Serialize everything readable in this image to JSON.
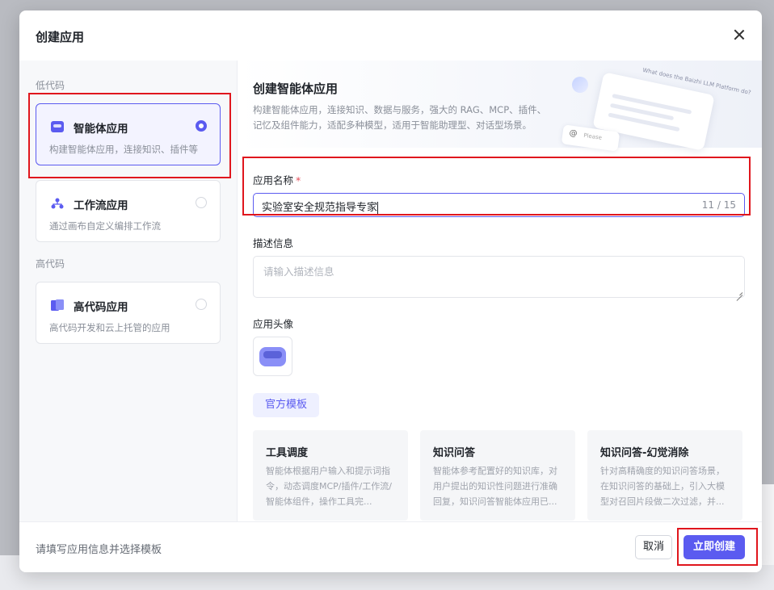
{
  "dialog": {
    "title": "创建应用"
  },
  "sidebar": {
    "low_code_label": "低代码",
    "high_code_label": "高代码",
    "types": [
      {
        "title": "智能体应用",
        "desc": "构建智能体应用，连接知识、插件等",
        "selected": true
      },
      {
        "title": "工作流应用",
        "desc": "通过画布自定义编排工作流",
        "selected": false
      },
      {
        "title": "高代码应用",
        "desc": "高代码开发和云上托管的应用",
        "selected": false
      }
    ]
  },
  "banner": {
    "title": "创建智能体应用",
    "desc": "构建智能体应用，连接知识、数据与服务，强大的 RAG、MCP、插件、记忆及组件能力，适配多种模型，适用于智能助理型、对话型场景。",
    "deco_text": "What does the Baizhi LLM Platform do?"
  },
  "form": {
    "name_label": "应用名称",
    "required_mark": "*",
    "name_value": "实验室安全规范指导专家",
    "name_count": "11 / 15",
    "desc_label": "描述信息",
    "desc_placeholder": "请输入描述信息",
    "avatar_label": "应用头像"
  },
  "templates": {
    "tab_label": "官方模板",
    "items": [
      {
        "title": "工具调度",
        "desc": "智能体根据用户输入和提示词指令，动态调度MCP/插件/工作流/智能体组件，操作工具完..."
      },
      {
        "title": "知识问答",
        "desc": "智能体参考配置好的知识库，对用户提出的知识性问题进行准确回复，知识问答智能体应用已..."
      },
      {
        "title": "知识问答-幻觉消除",
        "desc": "针对高精确度的知识问答场景，在知识问答的基础上，引入大模型对召回片段做二次过滤，并..."
      }
    ]
  },
  "footer": {
    "hint": "请填写应用信息并选择模板",
    "cancel_label": "取消",
    "create_label": "立即创建"
  },
  "colors": {
    "accent": "#5b5bf0",
    "highlight": "#e0161d"
  }
}
